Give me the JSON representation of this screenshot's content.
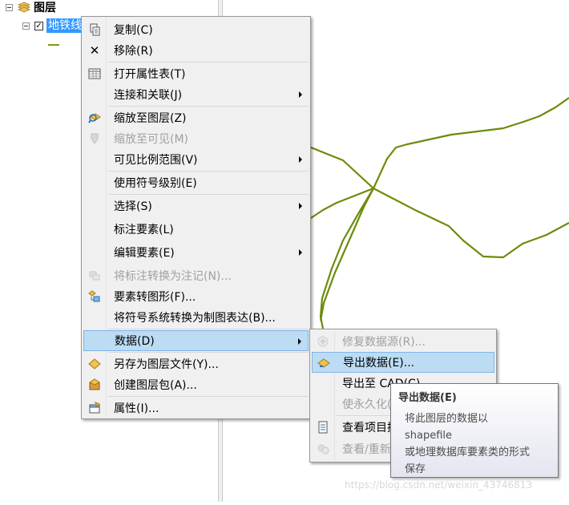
{
  "toc": {
    "layers_label": "图层",
    "layer_name": "地铁线",
    "layer_checked": "✓"
  },
  "context_menu": {
    "items": [
      {
        "label": "复制(C)",
        "icon": "copy-icon",
        "disabled": false,
        "submenu": false
      },
      {
        "label": "移除(R)",
        "icon": "remove-icon",
        "disabled": false,
        "submenu": false
      },
      {
        "label": "打开属性表(T)",
        "icon": "table-icon",
        "disabled": false,
        "submenu": false
      },
      {
        "label": "连接和关联(J)",
        "icon": "",
        "disabled": false,
        "submenu": true
      },
      {
        "label": "缩放至图层(Z)",
        "icon": "zoom-to-layer-icon",
        "disabled": false,
        "submenu": false
      },
      {
        "label": "缩放至可见(M)",
        "icon": "zoom-to-visible-icon",
        "disabled": true,
        "submenu": false
      },
      {
        "label": "可见比例范围(V)",
        "icon": "",
        "disabled": false,
        "submenu": true
      },
      {
        "label": "使用符号级别(E)",
        "icon": "",
        "disabled": false,
        "submenu": false
      },
      {
        "label": "选择(S)",
        "icon": "",
        "disabled": false,
        "submenu": true
      },
      {
        "label": "标注要素(L)",
        "icon": "",
        "disabled": false,
        "submenu": false
      },
      {
        "label": "编辑要素(E)",
        "icon": "",
        "disabled": false,
        "submenu": true
      },
      {
        "label": "将标注转换为注记(N)...",
        "icon": "convert-labels-icon",
        "disabled": true,
        "submenu": false
      },
      {
        "label": "要素转图形(F)...",
        "icon": "features-to-graphics-icon",
        "disabled": false,
        "submenu": false
      },
      {
        "label": "将符号系统转换为制图表达(B)...",
        "icon": "",
        "disabled": false,
        "submenu": false
      },
      {
        "label": "数据(D)",
        "icon": "",
        "disabled": false,
        "submenu": true,
        "highlight": true
      },
      {
        "label": "另存为图层文件(Y)...",
        "icon": "save-layer-icon",
        "disabled": false,
        "submenu": false
      },
      {
        "label": "创建图层包(A)...",
        "icon": "layer-package-icon",
        "disabled": false,
        "submenu": false
      },
      {
        "label": "属性(I)...",
        "icon": "properties-icon",
        "disabled": false,
        "submenu": false
      }
    ]
  },
  "data_submenu": {
    "items": [
      {
        "label": "修复数据源(R)...",
        "disabled": true,
        "icon": "repair-icon"
      },
      {
        "label": "导出数据(E)...",
        "disabled": false,
        "icon": "export-data-icon",
        "highlight": true
      },
      {
        "label": "导出至 CAD(C)...",
        "disabled": false,
        "icon": ""
      },
      {
        "label": "使永久化(P)",
        "disabled": true,
        "icon": ""
      },
      {
        "label": "查看项目描述(V)...",
        "disabled": false,
        "icon": "item-description-icon"
      },
      {
        "label": "查看/重新生成缓存",
        "disabled": true,
        "icon": "cache-icon"
      }
    ]
  },
  "tooltip": {
    "title": "导出数据(E)",
    "body_lines": [
      "将此图层的数据以",
      "shapefile",
      "或地理数据库要素类的形式",
      "保存"
    ]
  },
  "watermark": "https://blog.csdn.net/weixin_43746813",
  "colors": {
    "map_line": "#6b8c0a",
    "highlight": "#bcdcf4",
    "selection": "#3399ff"
  }
}
